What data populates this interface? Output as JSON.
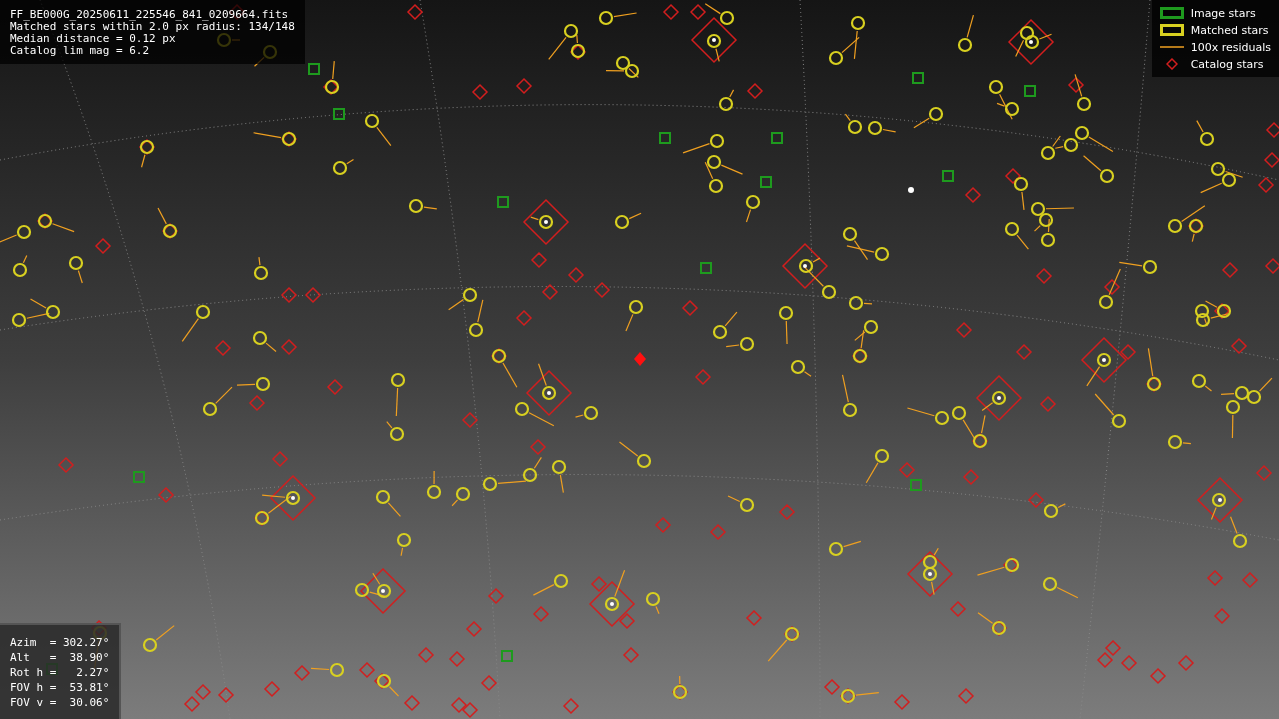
{
  "info_box": {
    "lines": [
      "FF_BE000G_20250611_225546_841_0209664.fits",
      "Matched stars within 2.0 px radius: 134/148",
      "Median distance = 0.12 px",
      "Catalog lim mag = 6.2"
    ]
  },
  "legend": [
    {
      "kind": "image",
      "label": "Image stars"
    },
    {
      "kind": "matched",
      "label": "Matched stars"
    },
    {
      "kind": "residual",
      "label": "100x residuals"
    },
    {
      "kind": "catalog",
      "label": "Catalog stars"
    }
  ],
  "pointing_box": {
    "lines": [
      "Azim  = 302.27°",
      "Alt   =  38.90°",
      "Rot h =   2.27°",
      "FOV h =  53.81°",
      "FOV v =  30.06°"
    ]
  }
}
